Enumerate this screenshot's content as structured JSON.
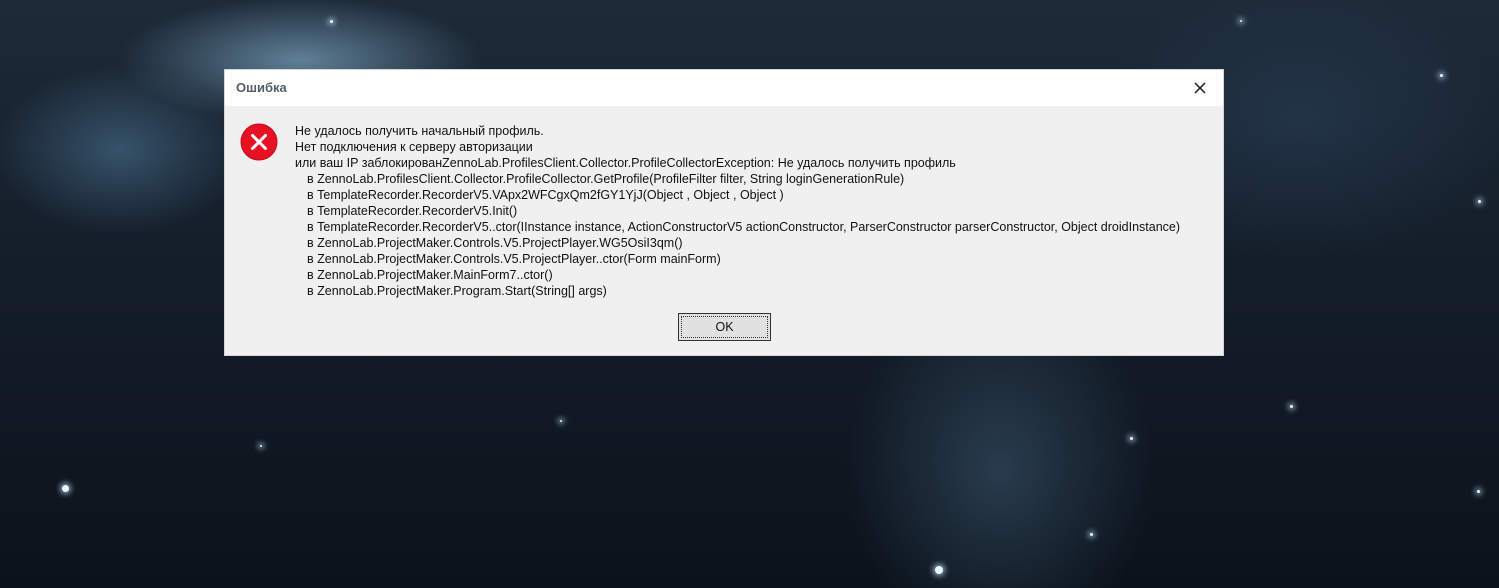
{
  "dialog": {
    "title": "Ошибка",
    "close_icon": "close-icon",
    "error_icon": "error-icon",
    "message_lines": [
      "Не удалось получить начальный профиль.",
      "Нет подключения к серверу авторизации",
      "или ваш IP заблокированZennoLab.ProfilesClient.Collector.ProfileCollectorException: Не удалось получить профиль"
    ],
    "stack_lines": [
      "в ZennoLab.ProfilesClient.Collector.ProfileCollector.GetProfile(ProfileFilter filter, String loginGenerationRule)",
      "в TemplateRecorder.RecorderV5.VApx2WFCgxQm2fGY1YjJ(Object , Object , Object )",
      "в TemplateRecorder.RecorderV5.Init()",
      "в TemplateRecorder.RecorderV5..ctor(IInstance instance, ActionConstructorV5 actionConstructor, ParserConstructor parserConstructor, Object droidInstance)",
      "в ZennoLab.ProjectMaker.Controls.V5.ProjectPlayer.WG5OsiI3qm()",
      "в ZennoLab.ProjectMaker.Controls.V5.ProjectPlayer..ctor(Form mainForm)",
      "в ZennoLab.ProjectMaker.MainForm7..ctor()",
      "в ZennoLab.ProjectMaker.Program.Start(String[] args)"
    ],
    "ok_label": "OK"
  },
  "colors": {
    "error_red": "#e81123",
    "dialog_bg": "#f0f0f0",
    "title_bg": "#ffffff"
  }
}
